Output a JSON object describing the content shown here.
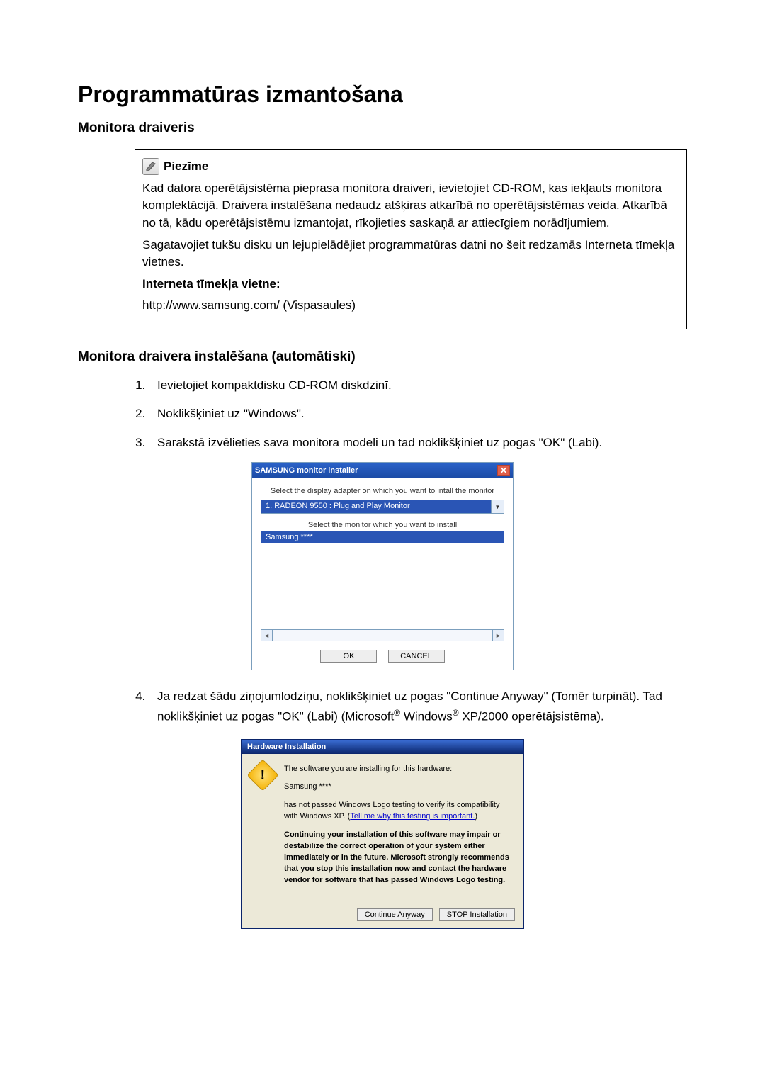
{
  "title": "Programmatūras izmantošana",
  "section1_heading": "Monitora draiveris",
  "note": {
    "label": "Piezīme",
    "p1": "Kad datora operētājsistēma pieprasa monitora draiveri, ievietojiet CD-ROM, kas iekļauts monitora komplektācijā. Draivera instalēšana nedaudz atšķiras atkarībā no operētājsistēmas veida. Atkarībā no tā, kādu operētājsistēmu izmantojat, rīkojieties saskaņā ar attiecīgiem norādījumiem.",
    "p2": "Sagatavojiet tukšu disku un lejupielādējiet programmatūras datni no šeit redzamās Interneta tīmekļa vietnes.",
    "site_label": "Interneta tīmekļa vietne:",
    "url": "http://www.samsung.com/ (Vispasaules)"
  },
  "section2_heading": "Monitora draivera instalēšana (automātiski)",
  "steps": {
    "s1": "Ievietojiet kompaktdisku CD-ROM diskdzinī.",
    "s2": "Noklikšķiniet uz \"Windows\".",
    "s3": "Sarakstā izvēlieties sava monitora modeli un tad noklikšķiniet uz pogas \"OK\" (Labi).",
    "s4a": "Ja redzat šādu ziņojumlodziņu, noklikšķiniet uz pogas \"Continue Anyway\" (Tomēr turpināt). Tad noklikšķiniet uz pogas \"OK\" (Labi) (Microsoft",
    "s4b": " Windows",
    "s4c": " XP/2000 operētājsistēma)."
  },
  "installer": {
    "title": "SAMSUNG monitor installer",
    "label1": "Select the display adapter on which you want to intall the monitor",
    "adapter": "1. RADEON 9550 : Plug and Play Monitor",
    "label2": "Select the monitor which you want to install",
    "model": "Samsung ****",
    "ok": "OK",
    "cancel": "CANCEL"
  },
  "hw": {
    "title": "Hardware Installation",
    "p1": "The software you are installing for this hardware:",
    "model": "Samsung ****",
    "p2a": "has not passed Windows Logo testing to verify its compatibility with Windows XP. (",
    "link": "Tell me why this testing is important.",
    "p2b": ")",
    "p3": "Continuing your installation of this software may impair or destabilize the correct operation of your system either immediately or in the future. Microsoft strongly recommends that you stop this installation now and contact the hardware vendor for software that has passed Windows Logo testing.",
    "continue": "Continue Anyway",
    "stop": "STOP Installation"
  }
}
